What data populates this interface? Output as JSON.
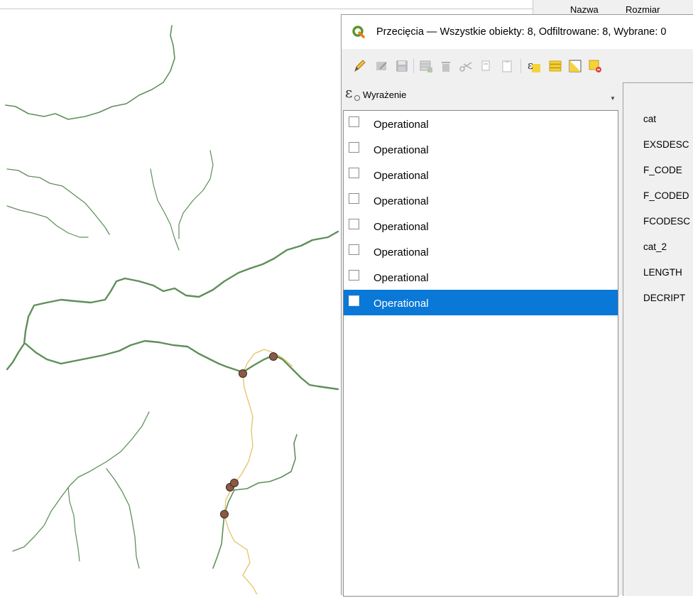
{
  "behind_panel": {
    "col1": "Nazwa",
    "col2": "Rozmiar"
  },
  "window": {
    "title": "Przecięcia — Wszystkie obiekty: 8, Odfiltrowane: 8, Wybrane: 0",
    "icon": "qgis-logo-icon"
  },
  "toolbar": {
    "items": [
      {
        "name": "toggle-edit-pencil-icon",
        "enabled": true
      },
      {
        "name": "multi-edit-icon",
        "enabled": false
      },
      {
        "name": "save-edits-icon",
        "enabled": false
      },
      {
        "name": "add-feature-icon",
        "enabled": false
      },
      {
        "name": "delete-feature-icon",
        "enabled": false
      },
      {
        "name": "cut-icon",
        "enabled": false
      },
      {
        "name": "copy-icon",
        "enabled": false
      },
      {
        "name": "paste-icon",
        "enabled": false
      },
      {
        "name": "select-by-expression-icon",
        "enabled": true
      },
      {
        "name": "select-all-icon",
        "enabled": true
      },
      {
        "name": "invert-selection-icon",
        "enabled": true
      },
      {
        "name": "deselect-all-icon",
        "enabled": true
      }
    ]
  },
  "expression": {
    "label": "Wyrażenie",
    "icon": "epsilon-icon"
  },
  "features": [
    {
      "label": "Operational",
      "selected": false
    },
    {
      "label": "Operational",
      "selected": false
    },
    {
      "label": "Operational",
      "selected": false
    },
    {
      "label": "Operational",
      "selected": false
    },
    {
      "label": "Operational",
      "selected": false
    },
    {
      "label": "Operational",
      "selected": false
    },
    {
      "label": "Operational",
      "selected": false
    },
    {
      "label": "Operational",
      "selected": true
    }
  ],
  "form_fields": [
    "cat",
    "EXSDESC",
    "F_CODE",
    "F_CODED",
    "FCODESC",
    "cat_2",
    "LENGTH",
    "DECRIPT"
  ],
  "colors": {
    "river": "#5f8f5a",
    "stream": "#e3c363",
    "point": "#8b5a45",
    "selection": "#0a78d7"
  }
}
